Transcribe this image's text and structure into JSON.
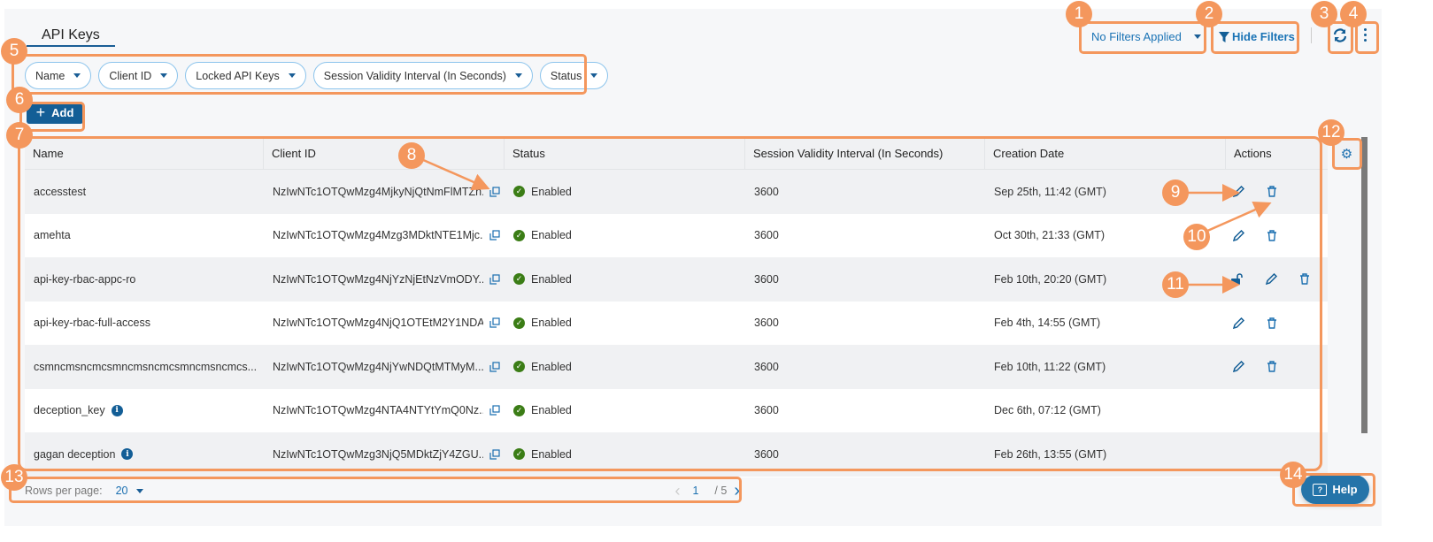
{
  "page_title": "API Keys",
  "toolbar": {
    "filters_applied": "No Filters Applied",
    "hide_filters": "Hide Filters"
  },
  "filters": [
    "Name",
    "Client ID",
    "Locked API Keys",
    "Session Validity Interval (In Seconds)",
    "Status"
  ],
  "add_label": "Add",
  "table": {
    "columns": [
      "Name",
      "Client ID",
      "Status",
      "Session Validity Interval (In Seconds)",
      "Creation Date",
      "Actions"
    ],
    "rows": [
      {
        "name": "accesstest",
        "client_id": "NzIwNTc1OTQwMzg4MjkyNjQtNmFlMTZh...",
        "status": "Enabled",
        "session": "3600",
        "created": "Sep 25th, 11:42 (GMT)",
        "actions": [
          "edit",
          "delete"
        ]
      },
      {
        "name": "amehta",
        "client_id": "NzIwNTc1OTQwMzg4Mzg3MDktNTE1Mjc...",
        "status": "Enabled",
        "session": "3600",
        "created": "Oct 30th, 21:33 (GMT)",
        "actions": [
          "edit",
          "delete"
        ]
      },
      {
        "name": "api-key-rbac-appc-ro",
        "client_id": "NzIwNTc1OTQwMzg4NjYzNjEtNzVmODY...",
        "status": "Enabled",
        "session": "3600",
        "created": "Feb 10th, 20:20 (GMT)",
        "actions": [
          "unlock",
          "edit",
          "delete"
        ]
      },
      {
        "name": "api-key-rbac-full-access",
        "client_id": "NzIwNTc1OTQwMzg4NjQ1OTEtM2Y1NDA...",
        "status": "Enabled",
        "session": "3600",
        "created": "Feb 4th, 14:55 (GMT)",
        "actions": [
          "edit",
          "delete"
        ]
      },
      {
        "name": "csmncmsncmcsmncmsncmcsmncmsncmcs...",
        "client_id": "NzIwNTc1OTQwMzg4NjYwNDQtMTMyM...",
        "status": "Enabled",
        "session": "3600",
        "created": "Feb 10th, 11:22 (GMT)",
        "actions": [
          "edit",
          "delete"
        ]
      },
      {
        "name": "deception_key",
        "info": true,
        "client_id": "NzIwNTc1OTQwMzg4NTA4NTYtYmQ0Nz...",
        "status": "Enabled",
        "session": "3600",
        "created": "Dec 6th, 07:12 (GMT)",
        "actions": []
      },
      {
        "name": "gagan deception",
        "info": true,
        "client_id": "NzIwNTc1OTQwMzg3NjQ5MDktZjY4ZGU...",
        "status": "Enabled",
        "session": "3600",
        "created": "Feb 26th, 13:55 (GMT)",
        "actions": []
      }
    ]
  },
  "pagination": {
    "rows_per_page_label": "Rows per page:",
    "rows_per_page": "20",
    "current_page": "1",
    "total_pages": "/ 5"
  },
  "help_label": "Help",
  "annotations": [
    "1",
    "2",
    "3",
    "4",
    "5",
    "6",
    "7",
    "8",
    "9",
    "10",
    "11",
    "12",
    "13",
    "14"
  ],
  "colors": {
    "accent": "#135e96",
    "annotation": "#f4975d",
    "enabled": "#3b7d16"
  }
}
